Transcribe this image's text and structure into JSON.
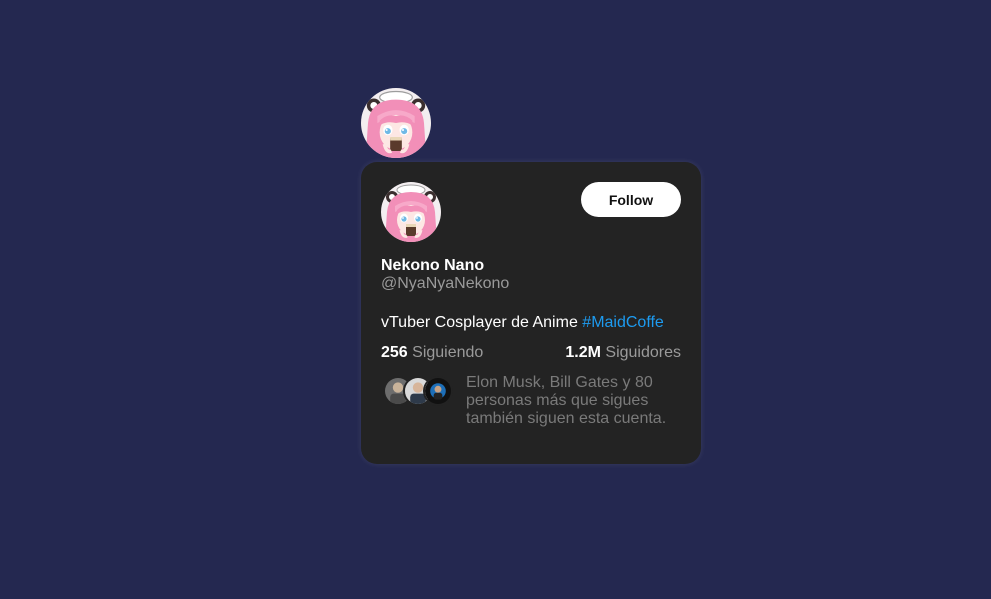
{
  "profile": {
    "name": "Nekono Nano",
    "handle": "@NyaNyaNekono",
    "bio_text": "vTuber Cosplayer de Anime",
    "bio_hashtag": "#MaidCoffe"
  },
  "follow_button": {
    "label": "Follow"
  },
  "stats": {
    "following_count": "256",
    "following_label": "Siguiendo",
    "followers_count": "1.2M",
    "followers_label": "Siguidores"
  },
  "mutuals": {
    "text": "Elon Musk, Bill Gates y 80 personas más que sigues también siguen esta cuenta."
  },
  "colors": {
    "page_background": "#242850",
    "card_background": "#232323",
    "hashtag": "#1d9bf0"
  }
}
